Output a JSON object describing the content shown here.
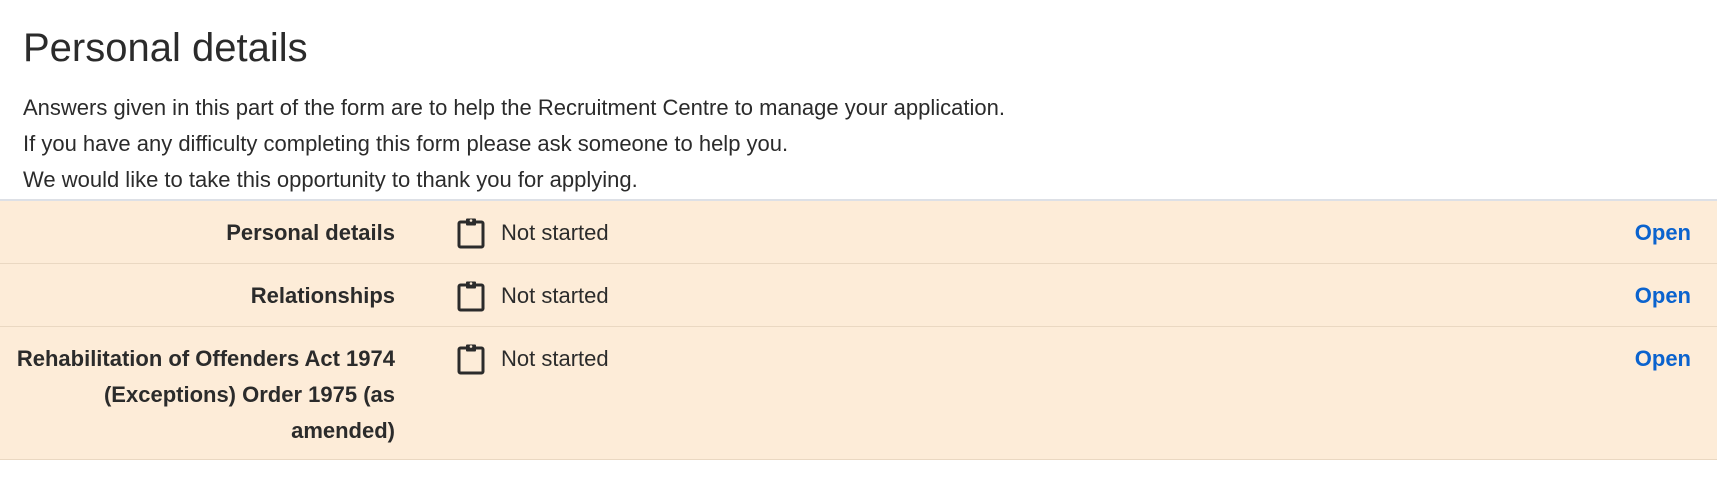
{
  "page": {
    "title": "Personal details",
    "intro_lines": [
      "Answers given in this part of the form are to help the Recruitment Centre to manage your application.",
      "If you have any difficulty completing this form please ask someone to help you.",
      "We would like to take this opportunity to thank you for applying."
    ]
  },
  "sections": [
    {
      "name": "Personal details",
      "status": "Not started",
      "action": "Open",
      "status_icon": "clipboard-icon"
    },
    {
      "name": "Relationships",
      "status": "Not started",
      "action": "Open",
      "status_icon": "clipboard-icon"
    },
    {
      "name": "Rehabilitation of Offenders Act 1974 (Exceptions) Order 1975 (as amended)",
      "status": "Not started",
      "action": "Open",
      "status_icon": "clipboard-icon"
    }
  ],
  "colors": {
    "row_background": "#fdecd8",
    "link": "#0b63ce",
    "text": "#2b2b2b"
  }
}
